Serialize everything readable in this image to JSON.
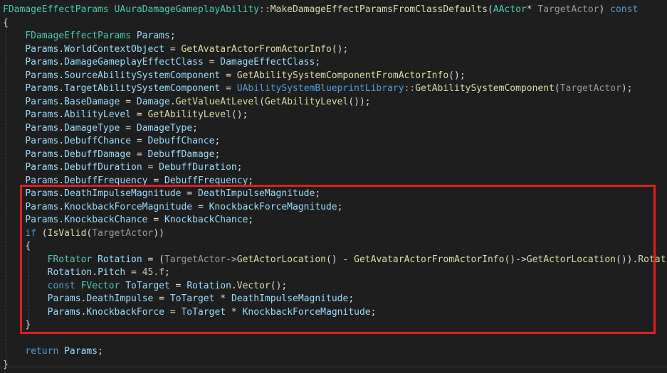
{
  "editor": {
    "language": "C++",
    "background_color": "#1e1e1e",
    "highlight_color": "#e01e1e"
  },
  "code": {
    "lines": [
      [
        [
          "FDamageEffectParams",
          "type"
        ],
        [
          " ",
          "text"
        ],
        [
          "UAuraDamageGameplayAbility",
          "type"
        ],
        [
          "::",
          "op"
        ],
        [
          "MakeDamageEffectParamsFromClassDefaults",
          "fn"
        ],
        [
          "(",
          "text"
        ],
        [
          "AActor",
          "type"
        ],
        [
          "* ",
          "text"
        ],
        [
          "TargetActor",
          "param"
        ],
        [
          ") ",
          "text"
        ],
        [
          "const",
          "kw"
        ]
      ],
      [
        [
          "{",
          "text"
        ]
      ],
      [
        [
          "    ",
          "text"
        ],
        [
          "FDamageEffectParams",
          "type"
        ],
        [
          " ",
          "text"
        ],
        [
          "Params",
          "var"
        ],
        [
          ";",
          "text"
        ]
      ],
      [
        [
          "    ",
          "text"
        ],
        [
          "Params",
          "var"
        ],
        [
          ".",
          "text"
        ],
        [
          "WorldContextObject",
          "var"
        ],
        [
          " = ",
          "text"
        ],
        [
          "GetAvatarActorFromActorInfo",
          "fn"
        ],
        [
          "();",
          "text"
        ]
      ],
      [
        [
          "    ",
          "text"
        ],
        [
          "Params",
          "var"
        ],
        [
          ".",
          "text"
        ],
        [
          "DamageGameplayEffectClass",
          "var"
        ],
        [
          " = ",
          "text"
        ],
        [
          "DamageEffectClass",
          "var"
        ],
        [
          ";",
          "text"
        ]
      ],
      [
        [
          "    ",
          "text"
        ],
        [
          "Params",
          "var"
        ],
        [
          ".",
          "text"
        ],
        [
          "SourceAbilitySystemComponent",
          "var"
        ],
        [
          " = ",
          "text"
        ],
        [
          "GetAbilitySystemComponentFromActorInfo",
          "fn"
        ],
        [
          "();",
          "text"
        ]
      ],
      [
        [
          "    ",
          "text"
        ],
        [
          "Params",
          "var"
        ],
        [
          ".",
          "text"
        ],
        [
          "TargetAbilitySystemComponent",
          "var"
        ],
        [
          " = ",
          "text"
        ],
        [
          "UAbilitySystemBlueprintLibrary",
          "kw"
        ],
        [
          "::",
          "op"
        ],
        [
          "GetAbilitySystemComponent",
          "fn"
        ],
        [
          "(",
          "text"
        ],
        [
          "TargetActor",
          "param"
        ],
        [
          ");",
          "text"
        ]
      ],
      [
        [
          "    ",
          "text"
        ],
        [
          "Params",
          "var"
        ],
        [
          ".",
          "text"
        ],
        [
          "BaseDamage",
          "var"
        ],
        [
          " = ",
          "text"
        ],
        [
          "Damage",
          "var"
        ],
        [
          ".",
          "text"
        ],
        [
          "GetValueAtLevel",
          "fn"
        ],
        [
          "(",
          "text"
        ],
        [
          "GetAbilityLevel",
          "fn"
        ],
        [
          "());",
          "text"
        ]
      ],
      [
        [
          "    ",
          "text"
        ],
        [
          "Params",
          "var"
        ],
        [
          ".",
          "text"
        ],
        [
          "AbilityLevel",
          "var"
        ],
        [
          " = ",
          "text"
        ],
        [
          "GetAbilityLevel",
          "fn"
        ],
        [
          "();",
          "text"
        ]
      ],
      [
        [
          "    ",
          "text"
        ],
        [
          "Params",
          "var"
        ],
        [
          ".",
          "text"
        ],
        [
          "DamageType",
          "var"
        ],
        [
          " = ",
          "text"
        ],
        [
          "DamageType",
          "var"
        ],
        [
          ";",
          "text"
        ]
      ],
      [
        [
          "    ",
          "text"
        ],
        [
          "Params",
          "var"
        ],
        [
          ".",
          "text"
        ],
        [
          "DebuffChance",
          "var"
        ],
        [
          " = ",
          "text"
        ],
        [
          "DebuffChance",
          "var"
        ],
        [
          ";",
          "text"
        ]
      ],
      [
        [
          "    ",
          "text"
        ],
        [
          "Params",
          "var"
        ],
        [
          ".",
          "text"
        ],
        [
          "DebuffDamage",
          "var"
        ],
        [
          " = ",
          "text"
        ],
        [
          "DebuffDamage",
          "var"
        ],
        [
          ";",
          "text"
        ]
      ],
      [
        [
          "    ",
          "text"
        ],
        [
          "Params",
          "var"
        ],
        [
          ".",
          "text"
        ],
        [
          "DebuffDuration",
          "var"
        ],
        [
          " = ",
          "text"
        ],
        [
          "DebuffDuration",
          "var"
        ],
        [
          ";",
          "text"
        ]
      ],
      [
        [
          "    ",
          "text"
        ],
        [
          "Params",
          "var"
        ],
        [
          ".",
          "text"
        ],
        [
          "DebuffFrequency",
          "var"
        ],
        [
          " = ",
          "text"
        ],
        [
          "DebuffFrequency",
          "var"
        ],
        [
          ";",
          "text"
        ]
      ],
      [
        [
          "    ",
          "text"
        ],
        [
          "Params",
          "var"
        ],
        [
          ".",
          "text"
        ],
        [
          "DeathImpulseMagnitude",
          "var"
        ],
        [
          " = ",
          "text"
        ],
        [
          "DeathImpulseMagnitude",
          "var"
        ],
        [
          ";",
          "text"
        ]
      ],
      [
        [
          "    ",
          "text"
        ],
        [
          "Params",
          "var"
        ],
        [
          ".",
          "text"
        ],
        [
          "KnockbackForceMagnitude",
          "var"
        ],
        [
          " = ",
          "text"
        ],
        [
          "KnockbackForceMagnitude",
          "var"
        ],
        [
          ";",
          "text"
        ]
      ],
      [
        [
          "    ",
          "text"
        ],
        [
          "Params",
          "var"
        ],
        [
          ".",
          "text"
        ],
        [
          "KnockbackChance",
          "var"
        ],
        [
          " = ",
          "text"
        ],
        [
          "KnockbackChance",
          "var"
        ],
        [
          ";",
          "text"
        ]
      ],
      [
        [
          "    ",
          "text"
        ],
        [
          "if",
          "kw"
        ],
        [
          " (",
          "text"
        ],
        [
          "IsValid",
          "fn"
        ],
        [
          "(",
          "text"
        ],
        [
          "TargetActor",
          "param"
        ],
        [
          "))",
          "text"
        ]
      ],
      [
        [
          "    ",
          "text"
        ],
        [
          "{",
          "text"
        ]
      ],
      [
        [
          "        ",
          "text"
        ],
        [
          "FRotator",
          "type"
        ],
        [
          " ",
          "text"
        ],
        [
          "Rotation",
          "var"
        ],
        [
          " = (",
          "text"
        ],
        [
          "TargetActor",
          "param"
        ],
        [
          "->",
          "op"
        ],
        [
          "GetActorLocation",
          "fn"
        ],
        [
          "() - ",
          "text"
        ],
        [
          "GetAvatarActorFromActorInfo",
          "fn"
        ],
        [
          "()->",
          "text"
        ],
        [
          "GetActorLocation",
          "fn"
        ],
        [
          "()).",
          "text"
        ],
        [
          "Rotation",
          "fn"
        ],
        [
          "();",
          "text"
        ]
      ],
      [
        [
          "        ",
          "text"
        ],
        [
          "Rotation",
          "var"
        ],
        [
          ".",
          "text"
        ],
        [
          "Pitch",
          "var"
        ],
        [
          " = ",
          "text"
        ],
        [
          "45.f",
          "num"
        ],
        [
          ";",
          "text"
        ]
      ],
      [
        [
          "        ",
          "text"
        ],
        [
          "const",
          "kw"
        ],
        [
          " ",
          "text"
        ],
        [
          "FVector",
          "type"
        ],
        [
          " ",
          "text"
        ],
        [
          "ToTarget",
          "var"
        ],
        [
          " = ",
          "text"
        ],
        [
          "Rotation",
          "var"
        ],
        [
          ".",
          "text"
        ],
        [
          "Vector",
          "fn"
        ],
        [
          "();",
          "text"
        ]
      ],
      [
        [
          "        ",
          "text"
        ],
        [
          "Params",
          "var"
        ],
        [
          ".",
          "text"
        ],
        [
          "DeathImpulse",
          "var"
        ],
        [
          " = ",
          "text"
        ],
        [
          "ToTarget",
          "var"
        ],
        [
          " * ",
          "text"
        ],
        [
          "DeathImpulseMagnitude",
          "var"
        ],
        [
          ";",
          "text"
        ]
      ],
      [
        [
          "        ",
          "text"
        ],
        [
          "Params",
          "var"
        ],
        [
          ".",
          "text"
        ],
        [
          "KnockbackForce",
          "var"
        ],
        [
          " = ",
          "text"
        ],
        [
          "ToTarget",
          "var"
        ],
        [
          " * ",
          "text"
        ],
        [
          "KnockbackForceMagnitude",
          "var"
        ],
        [
          ";",
          "text"
        ]
      ],
      [
        [
          "    ",
          "text"
        ],
        [
          "}",
          "text"
        ]
      ],
      [
        [
          "",
          "text"
        ]
      ],
      [
        [
          "    ",
          "text"
        ],
        [
          "return",
          "kw"
        ],
        [
          " ",
          "text"
        ],
        [
          "Params",
          "var"
        ],
        [
          ";",
          "text"
        ]
      ],
      [
        [
          "}",
          "text"
        ]
      ]
    ]
  }
}
